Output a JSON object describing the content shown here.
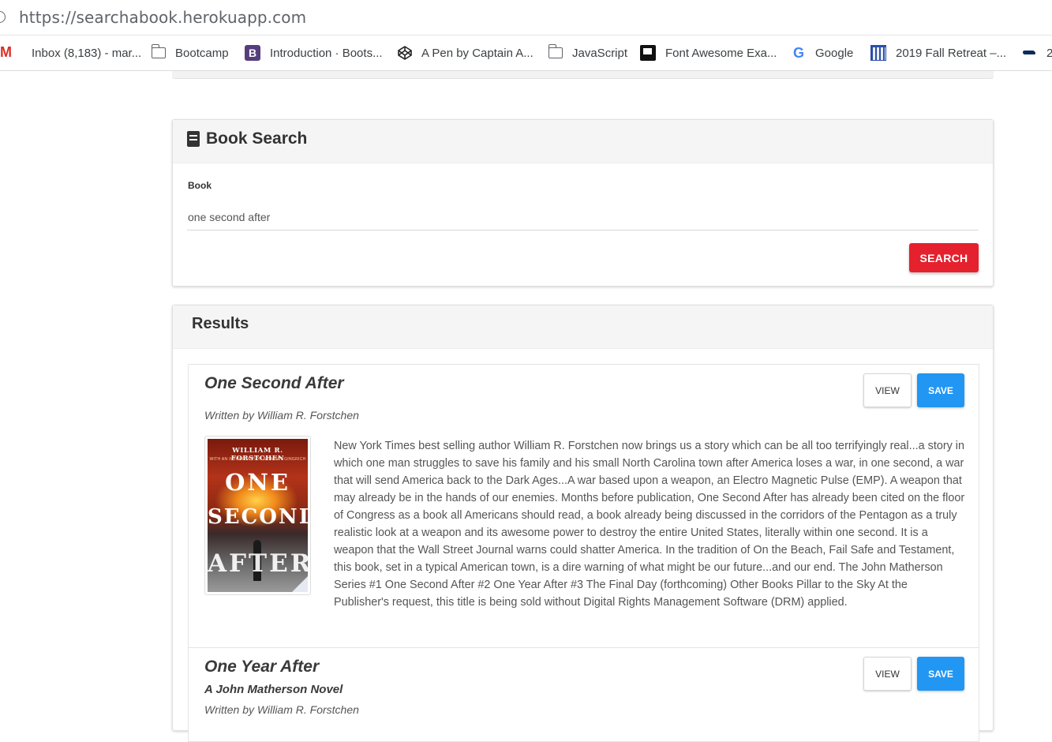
{
  "browser": {
    "url": "https://searchabook.herokuapp.com",
    "bookmarks": [
      {
        "label": "Inbox (8,183) - mar...",
        "icon": "gmail-icon"
      },
      {
        "label": "Bootcamp",
        "icon": "folder-icon"
      },
      {
        "label": "Introduction · Boots...",
        "icon": "bootstrap-icon"
      },
      {
        "label": "A Pen by Captain A...",
        "icon": "codepen-icon"
      },
      {
        "label": "JavaScript",
        "icon": "folder-icon"
      },
      {
        "label": "Font Awesome Exa...",
        "icon": "flag-icon"
      },
      {
        "label": "Google",
        "icon": "google-icon"
      },
      {
        "label": "2019 Fall Retreat –...",
        "icon": "grid-icon"
      },
      {
        "label": "2",
        "icon": "seahawks-icon"
      }
    ]
  },
  "search": {
    "title": "Book Search",
    "label": "Book",
    "value": "one second after",
    "button": "SEARCH"
  },
  "results": {
    "title": "Results",
    "items": [
      {
        "title": "One Second After",
        "author": "Written by William R. Forstchen",
        "view": "VIEW",
        "save": "SAVE",
        "cover": {
          "author": "WILLIAM R. FORSTCHEN",
          "intro": "WITH AN INTRODUCTION BY NEWT GINGRICH",
          "words": [
            "ONE",
            "SECOND",
            "AFTER"
          ]
        },
        "description": "New York Times best selling author William R. Forstchen now brings us a story which can be all too terrifyingly real...a story in which one man struggles to save his family and his small North Carolina town after America loses a war, in one second, a war that will send America back to the Dark Ages...A war based upon a weapon, an Electro Magnetic Pulse (EMP). A weapon that may already be in the hands of our enemies. Months before publication, One Second After has already been cited on the floor of Congress as a book all Americans should read, a book already being discussed in the corridors of the Pentagon as a truly realistic look at a weapon and its awesome power to destroy the entire United States, literally within one second. It is a weapon that the Wall Street Journal warns could shatter America. In the tradition of On the Beach, Fail Safe and Testament, this book, set in a typical American town, is a dire warning of what might be our future...and our end. The John Matherson Series #1 One Second After #2 One Year After #3 The Final Day (forthcoming) Other Books Pillar to the Sky At the Publisher's request, this title is being sold without Digital Rights Management Software (DRM) applied."
      },
      {
        "title": "One Year After",
        "subtitle": "A John Matherson Novel",
        "author": "Written by William R. Forstchen",
        "view": "VIEW",
        "save": "SAVE"
      }
    ]
  },
  "colors": {
    "search_button": "#e5212d",
    "save_button": "#2196f3",
    "header_bg": "#f5f5f5"
  }
}
